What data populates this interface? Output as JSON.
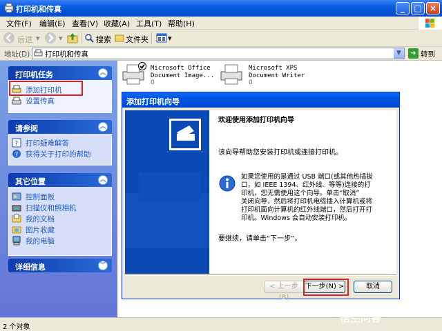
{
  "window": {
    "title": "打印机和传真"
  },
  "menu": {
    "items": [
      "文件(F)",
      "编辑(E)",
      "查看(V)",
      "收藏(A)",
      "工具(T)",
      "帮助(H)"
    ]
  },
  "toolbar": {
    "back": "后退",
    "search": "搜索",
    "folders": "文件夹"
  },
  "address": {
    "label": "地址(D)",
    "value": "打印机和传真",
    "go": "转到"
  },
  "panels": {
    "printer_tasks": {
      "title": "打印机任务",
      "items": [
        "添加打印机",
        "设置传真"
      ]
    },
    "see_also": {
      "title": "请参阅",
      "items": [
        "打印疑难解答",
        "获得关于打印的帮助"
      ]
    },
    "other_places": {
      "title": "其它位置",
      "items": [
        "控制面板",
        "扫描仪和照相机",
        "我的文档",
        "图片收藏",
        "我的电脑"
      ]
    },
    "details": {
      "title": "详细信息"
    }
  },
  "printers": [
    {
      "line1": "Microsoft Office",
      "line2": "Document Image...",
      "count": "0"
    },
    {
      "line1": "Microsoft XPS",
      "line2": "Document Writer",
      "count": "0"
    }
  ],
  "wizard": {
    "title": "添加打印机向导",
    "heading": "欢迎使用添加打印机向导",
    "intro": "该向导帮助您安装打印机或连接打印机。",
    "info_lines": [
      "如果您使用的是通过 USB 端口(或其他热插拔",
      "口，如 IEEE 1394、红外线、等等)连接的打",
      "印机，您无需使用这个向导。单击“取消”",
      "关闭向导，然后将打印机电缆插入计算机或将",
      "打印机面向计算机的红外线端口，然后打开打",
      "印机。Windows 会自动安装打印机。"
    ],
    "continue": "要继续，请单击“下一步”。",
    "back": "< 上一步(B)",
    "next": "下一步(N) >",
    "cancel": "取消"
  },
  "status": {
    "text": "2 个对象"
  },
  "watermark": "悟空问答",
  "colors": {
    "xp_blue": "#0A5BE4",
    "panel_link": "#215DC6",
    "highlight": "#E02020"
  }
}
